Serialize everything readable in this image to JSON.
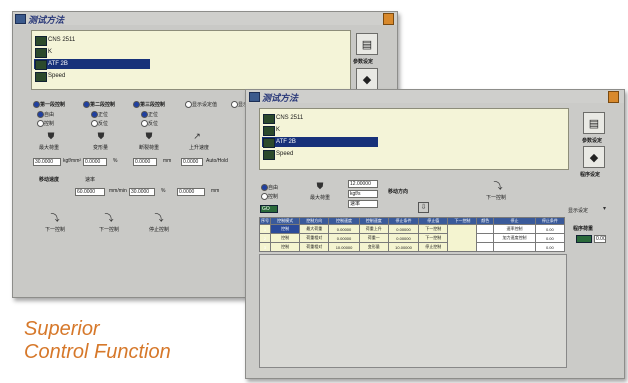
{
  "back_window": {
    "title": "测试方法",
    "list_items": [
      "CNS 2511",
      "K",
      "ATF 2B",
      "Speed"
    ],
    "selected_index": 2,
    "side_buttons": [
      {
        "icon": "panel-icon",
        "label": "参数设定"
      },
      {
        "icon": "gauge-icon",
        "label": ""
      }
    ],
    "checks": [
      "第一段控制",
      "第二段控制",
      "第三段控制",
      "显示设定值",
      "显示"
    ],
    "radio_col1": [
      "自由",
      "控制"
    ],
    "radio_col2": [
      "正位",
      "反位"
    ],
    "radio_col3": [
      "正位",
      "反位"
    ],
    "tool_labels": [
      "最大荷重",
      "变形量",
      "断裂荷重",
      "上升速度",
      ""
    ],
    "field_row1": [
      "30.0000",
      "kgf/mm²",
      "0.0000",
      "%",
      "0.0000",
      "mm",
      "0.0000",
      "Auto/Hold"
    ],
    "speed_row": [
      "移动速度",
      "速率",
      "60.0000",
      "mm/min",
      "30.0000",
      "%",
      "0.0000",
      "mm"
    ],
    "bottom_tools": [
      "下一控制",
      "下一控制",
      "停止控制"
    ]
  },
  "front_window": {
    "title": "测试方法",
    "list_items": [
      "CNS 2511",
      "K",
      "ATF 2B",
      "Speed"
    ],
    "selected_index": 2,
    "side_buttons": [
      {
        "icon": "panel-icon",
        "label": "参数设定"
      },
      {
        "icon": "gauge-icon",
        "label": "程序设定"
      }
    ],
    "radios": [
      "自由",
      "控制"
    ],
    "value_field": "12.00000",
    "unit_field": "kgf/s",
    "small_field": "速率",
    "tool_labels": [
      "最大荷重",
      "移动方向",
      "下一控制"
    ],
    "go_label": "GO",
    "right_dropdown": "显示设定",
    "table_header": [
      "序号",
      "控制模式",
      "控制方向",
      "控制速度",
      "控制速度",
      "停止条件",
      "停止值",
      "下一控制",
      "颜色",
      "停止",
      "停止条件",
      "控制"
    ],
    "rows": [
      [
        "1",
        "控制",
        "最大荷重",
        "0.00000",
        "荷重上升",
        "0.00000",
        "下一控制",
        "",
        "",
        "速率控制",
        "0.00"
      ],
      [
        "2",
        "控制",
        "荷重相对",
        "0.00000",
        "荷重一",
        "0.00000",
        "下一控制",
        "",
        "",
        "加力速度控制",
        "0.00"
      ],
      [
        "3",
        "控制",
        "荷重相对",
        "10.00000",
        "变形量",
        "10.00000",
        "停止控制",
        "",
        "",
        "",
        "0.00"
      ]
    ],
    "result_label": "程序荷重",
    "result_value": "0.00"
  },
  "caption": {
    "line1": "Superior",
    "line2": "Control Function",
    "color": "#d6782a"
  },
  "colors": {
    "window": "#c9c9c6",
    "list_bg": "#f4f4d8",
    "selection": "#17317a",
    "grid_head": "#3a5a9a",
    "teal": "#1f8a8a"
  }
}
